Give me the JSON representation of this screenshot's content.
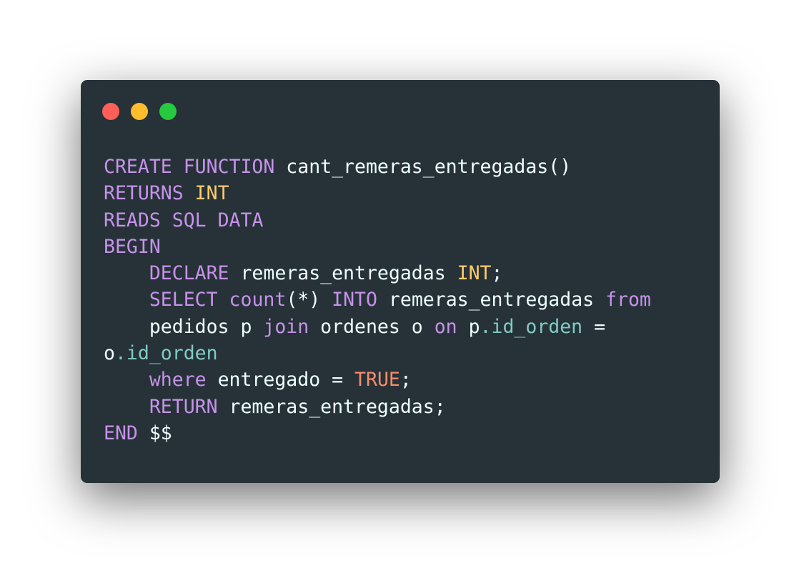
{
  "window": {
    "background": "#263238",
    "controls": {
      "close_color": "#ff5f56",
      "minimize_color": "#ffbd2e",
      "maximize_color": "#27c93f"
    }
  },
  "colors": {
    "keyword": "#c792ea",
    "type": "#ffcb6b",
    "text": "#eeffff",
    "property": "#80cbc4",
    "literal": "#f78c6c"
  },
  "code": {
    "lines": [
      [
        {
          "t": "CREATE",
          "k": "keyword"
        },
        {
          "t": " ",
          "k": "text"
        },
        {
          "t": "FUNCTION",
          "k": "keyword"
        },
        {
          "t": " cant_remeras_entregadas()",
          "k": "text"
        }
      ],
      [
        {
          "t": "RETURNS",
          "k": "keyword"
        },
        {
          "t": " ",
          "k": "text"
        },
        {
          "t": "INT",
          "k": "type"
        }
      ],
      [
        {
          "t": "READS",
          "k": "keyword"
        },
        {
          "t": " ",
          "k": "text"
        },
        {
          "t": "SQL",
          "k": "keyword"
        },
        {
          "t": " ",
          "k": "text"
        },
        {
          "t": "DATA",
          "k": "keyword"
        }
      ],
      [
        {
          "t": "BEGIN",
          "k": "keyword"
        }
      ],
      [
        {
          "t": "    ",
          "k": "text"
        },
        {
          "t": "DECLARE",
          "k": "keyword"
        },
        {
          "t": " remeras_entregadas ",
          "k": "text"
        },
        {
          "t": "INT",
          "k": "type"
        },
        {
          "t": ";",
          "k": "text"
        }
      ],
      [
        {
          "t": "    ",
          "k": "text"
        },
        {
          "t": "SELECT",
          "k": "keyword"
        },
        {
          "t": " ",
          "k": "text"
        },
        {
          "t": "count",
          "k": "keyword"
        },
        {
          "t": "(*) ",
          "k": "text"
        },
        {
          "t": "INTO",
          "k": "keyword"
        },
        {
          "t": " remeras_entregadas ",
          "k": "text"
        },
        {
          "t": "from",
          "k": "keyword"
        }
      ],
      [
        {
          "t": "    pedidos p ",
          "k": "text"
        },
        {
          "t": "join",
          "k": "keyword"
        },
        {
          "t": " ordenes o ",
          "k": "text"
        },
        {
          "t": "on",
          "k": "keyword"
        },
        {
          "t": " p",
          "k": "text"
        },
        {
          "t": ".id_orden",
          "k": "property"
        },
        {
          "t": " =",
          "k": "text"
        }
      ],
      [
        {
          "t": "o",
          "k": "text"
        },
        {
          "t": ".id_orden",
          "k": "property"
        }
      ],
      [
        {
          "t": "    ",
          "k": "text"
        },
        {
          "t": "where",
          "k": "keyword"
        },
        {
          "t": " entregado = ",
          "k": "text"
        },
        {
          "t": "TRUE",
          "k": "literal"
        },
        {
          "t": ";",
          "k": "text"
        }
      ],
      [
        {
          "t": "    ",
          "k": "text"
        },
        {
          "t": "RETURN",
          "k": "keyword"
        },
        {
          "t": " remeras_entregadas;",
          "k": "text"
        }
      ],
      [
        {
          "t": "END",
          "k": "keyword"
        },
        {
          "t": " $$",
          "k": "text"
        }
      ]
    ]
  }
}
